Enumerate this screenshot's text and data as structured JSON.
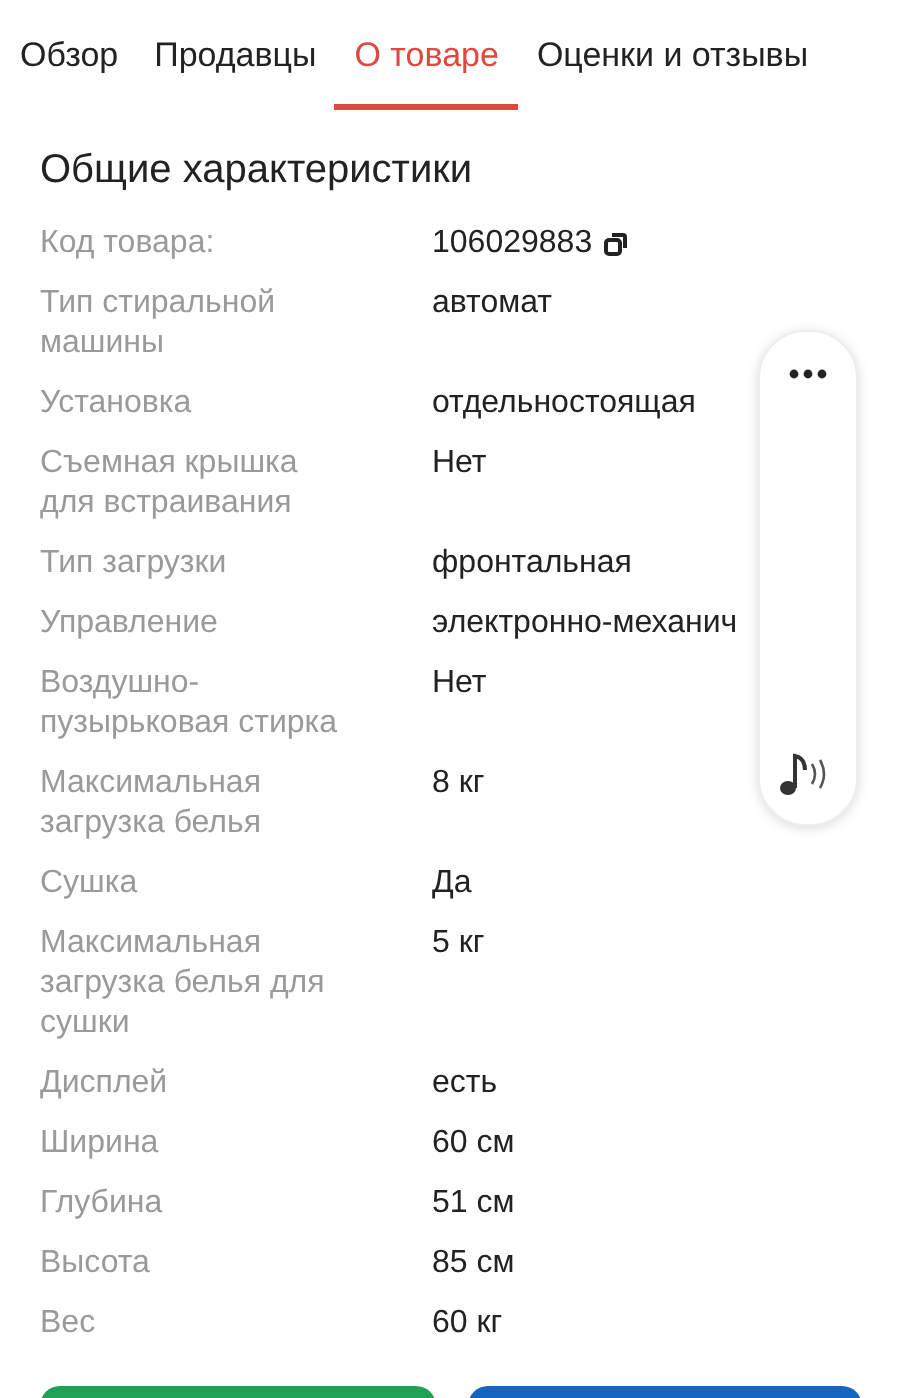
{
  "tabs": [
    {
      "label": "Обзор",
      "selected": false
    },
    {
      "label": "Продавцы",
      "selected": false
    },
    {
      "label": "О товаре",
      "selected": true
    },
    {
      "label": "Оценки и отзывы",
      "selected": false
    }
  ],
  "section_title": "Общие характеристики",
  "specs": [
    {
      "label": "Код товара:",
      "value": "106029883",
      "copyable": true
    },
    {
      "label": "Тип стиральной машины",
      "value": "автомат",
      "copyable": false
    },
    {
      "label": "Установка",
      "value": "отдельностоящая",
      "copyable": false
    },
    {
      "label": "Съемная крышка для встраивания",
      "value": "Нет",
      "copyable": false
    },
    {
      "label": "Тип загрузки",
      "value": "фронтальная",
      "copyable": false
    },
    {
      "label": "Управление",
      "value": "электронно-механич",
      "copyable": false
    },
    {
      "label": "Воздушно-пузырьковая стирка",
      "value": "Нет",
      "copyable": false
    },
    {
      "label": "Максимальная загрузка белья",
      "value": "8 кг",
      "copyable": false
    },
    {
      "label": "Сушка",
      "value": "Да",
      "copyable": false
    },
    {
      "label": "Максимальная загрузка белья для сушки",
      "value": "5 кг",
      "copyable": false
    },
    {
      "label": "Дисплей",
      "value": "есть",
      "copyable": false
    },
    {
      "label": "Ширина",
      "value": "60 см",
      "copyable": false
    },
    {
      "label": "Глубина",
      "value": "51 см",
      "copyable": false
    },
    {
      "label": "Высота",
      "value": "85 см",
      "copyable": false
    },
    {
      "label": "Вес",
      "value": "60 кг",
      "copyable": false
    }
  ],
  "bottom_buttons": [
    {
      "color": "#1fa254"
    },
    {
      "color": "#1565c0"
    }
  ]
}
